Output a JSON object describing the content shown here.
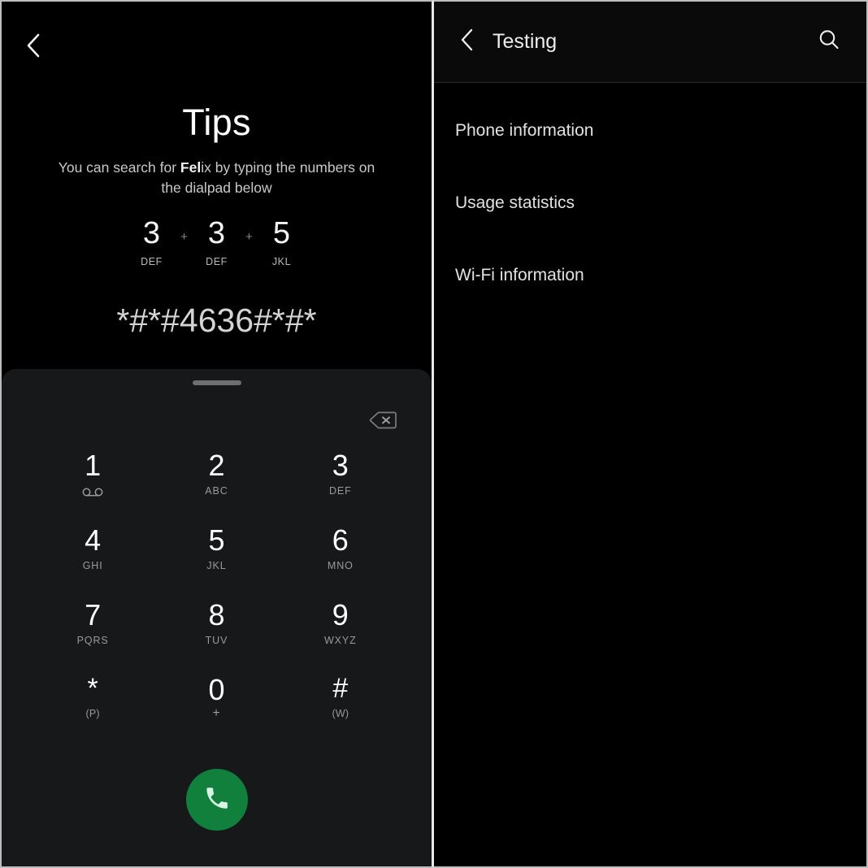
{
  "left_screen": {
    "back_icon": "chevron-left-icon",
    "tips": {
      "title": "Tips",
      "hint_prefix": "You can search for ",
      "hint_bold": "Fel",
      "hint_suffix": "ix by typing the numbers on the dialpad below",
      "digit_sequence": [
        {
          "num": "3",
          "letters": "DEF"
        },
        {
          "num": "3",
          "letters": "DEF"
        },
        {
          "num": "5",
          "letters": "JKL"
        }
      ],
      "separator": "+",
      "dial_code": "*#*#4636#*#*"
    },
    "dialpad": {
      "handle_icon": "drag-handle-icon",
      "backspace_icon": "backspace-icon",
      "keys": [
        {
          "num": "1",
          "sub": "",
          "icon": "voicemail-icon"
        },
        {
          "num": "2",
          "sub": "ABC",
          "icon": ""
        },
        {
          "num": "3",
          "sub": "DEF",
          "icon": ""
        },
        {
          "num": "4",
          "sub": "GHI",
          "icon": ""
        },
        {
          "num": "5",
          "sub": "JKL",
          "icon": ""
        },
        {
          "num": "6",
          "sub": "MNO",
          "icon": ""
        },
        {
          "num": "7",
          "sub": "PQRS",
          "icon": ""
        },
        {
          "num": "8",
          "sub": "TUV",
          "icon": ""
        },
        {
          "num": "9",
          "sub": "WXYZ",
          "icon": ""
        },
        {
          "num": "*",
          "sub": "(P)",
          "icon": ""
        },
        {
          "num": "0",
          "sub": "+",
          "icon": ""
        },
        {
          "num": "#",
          "sub": "(W)",
          "icon": ""
        }
      ],
      "call_button": {
        "icon": "phone-call-icon",
        "color": "#12803d"
      }
    }
  },
  "right_screen": {
    "appbar": {
      "back_icon": "chevron-left-icon",
      "title": "Testing",
      "search_icon": "search-icon"
    },
    "menu_items": [
      {
        "label": "Phone information"
      },
      {
        "label": "Usage statistics"
      },
      {
        "label": "Wi-Fi information"
      }
    ]
  },
  "colors": {
    "background": "#000000",
    "sheet": "#161819",
    "accent_green": "#12803d",
    "text_primary": "#ffffff",
    "text_secondary": "#9a9a9a"
  }
}
